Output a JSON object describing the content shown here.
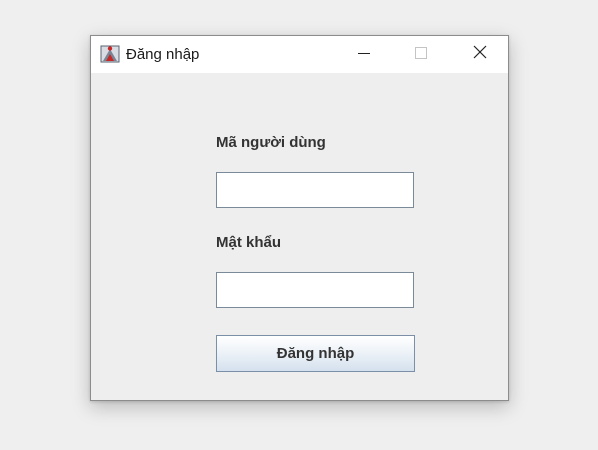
{
  "window": {
    "title": "Đăng nhập",
    "app_icon": "java-app-icon",
    "controls": {
      "minimize_icon": "minimize-icon",
      "maximize_icon": "maximize-icon",
      "close_icon": "close-icon"
    }
  },
  "form": {
    "username_label": "Mã người dùng",
    "username_value": "",
    "password_label": "Mật khẩu",
    "password_value": "",
    "login_button_label": "Đăng nhập"
  },
  "colors": {
    "desktop_background": "#efefef",
    "window_background": "#eeeeee",
    "titlebar_background": "#ffffff",
    "button_gradient_bottom": "#d5e1ee"
  }
}
